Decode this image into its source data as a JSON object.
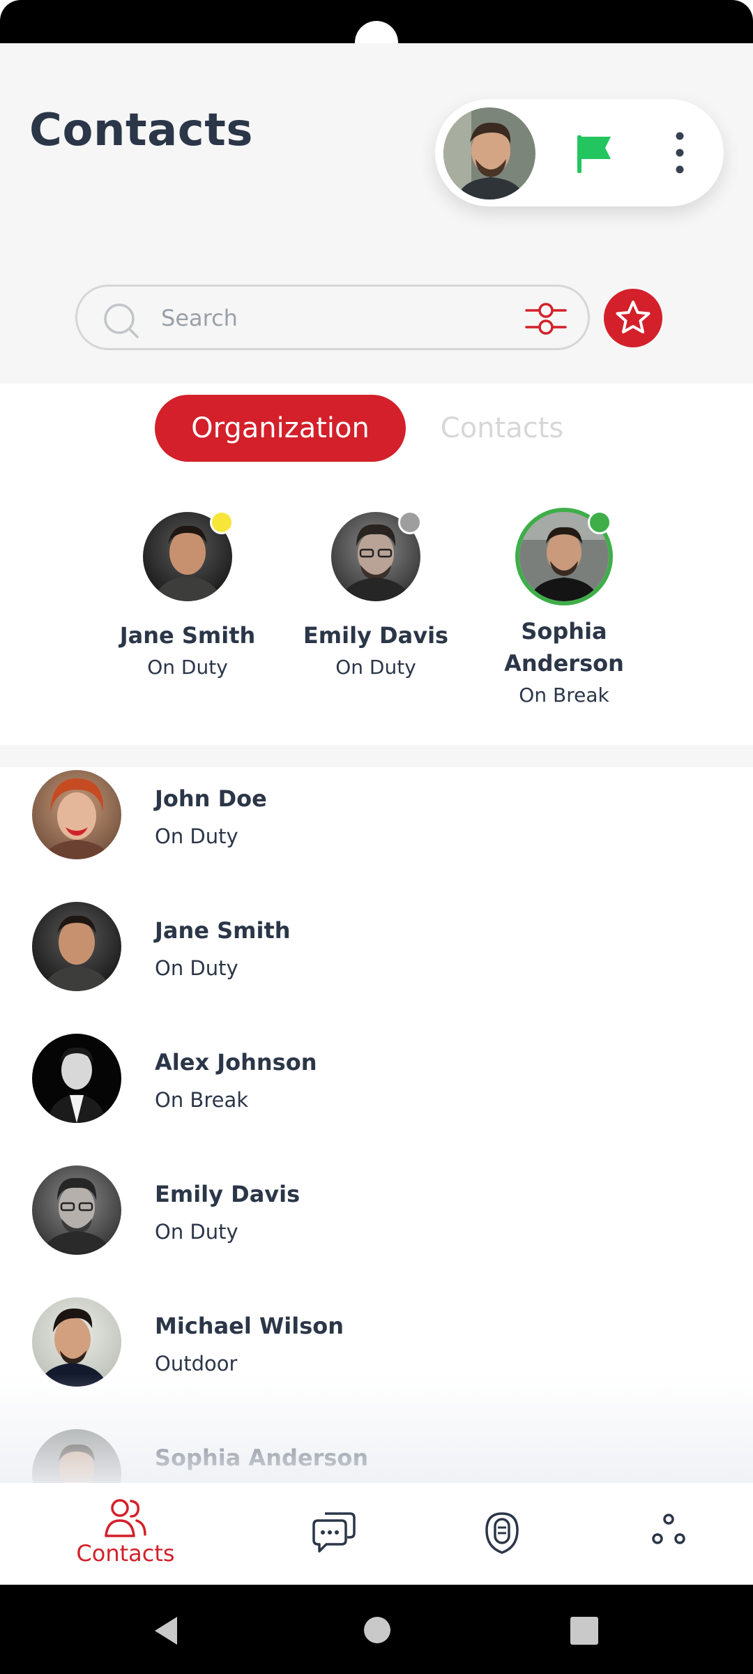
{
  "header": {
    "title": "Contacts",
    "search_placeholder": "Search"
  },
  "colors": {
    "accent": "#d3202a",
    "text": "#2b3648",
    "flag": "#22c55e",
    "status_on_duty": "#f7e53a",
    "status_offline": "#9e9e9e",
    "status_available": "#3fae49"
  },
  "tabs": [
    {
      "label": "Organization",
      "active": true
    },
    {
      "label": "Contacts",
      "active": false
    }
  ],
  "favorites": [
    {
      "name": "Jane Smith",
      "status": "On Duty"
    },
    {
      "name": "Emily Davis",
      "status": "On Duty"
    },
    {
      "name": "Sophia Anderson",
      "status": "On Break"
    }
  ],
  "contacts": [
    {
      "name": "John Doe",
      "status": "On Duty"
    },
    {
      "name": "Jane Smith",
      "status": "On Duty"
    },
    {
      "name": "Alex Johnson",
      "status": "On Break"
    },
    {
      "name": "Emily Davis",
      "status": "On Duty"
    },
    {
      "name": "Michael Wilson",
      "status": "Outdoor"
    },
    {
      "name": "Sophia Anderson",
      "status": ""
    }
  ],
  "bottom_nav": [
    {
      "label": "Contacts",
      "icon": "contacts-icon",
      "active": true
    },
    {
      "label": "",
      "icon": "chat-icon",
      "active": false
    },
    {
      "label": "",
      "icon": "voice-icon",
      "active": false
    },
    {
      "label": "",
      "icon": "more-apps-icon",
      "active": false
    }
  ]
}
